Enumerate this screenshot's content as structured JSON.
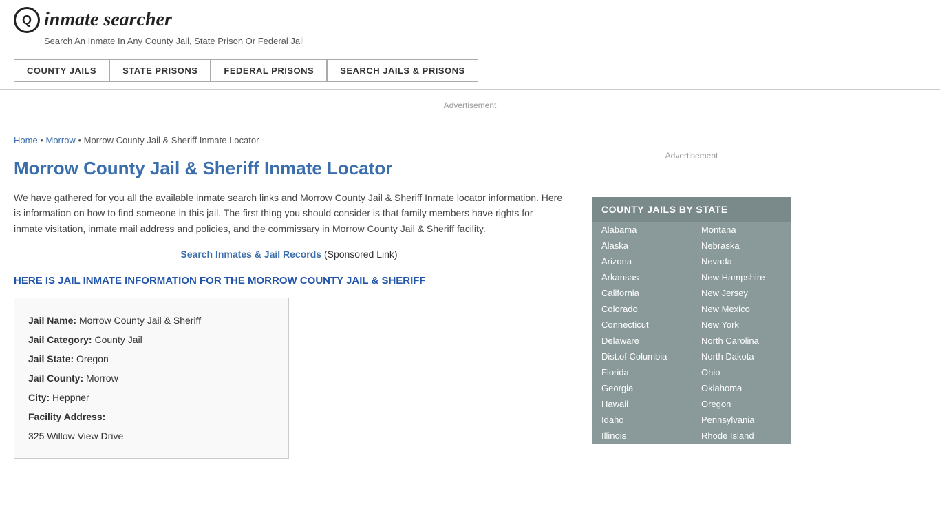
{
  "header": {
    "logo_icon": "Q",
    "logo_text": "inmate searcher",
    "tagline": "Search An Inmate In Any County Jail, State Prison Or Federal Jail"
  },
  "nav": {
    "buttons": [
      {
        "label": "COUNTY JAILS",
        "id": "county-jails"
      },
      {
        "label": "STATE PRISONS",
        "id": "state-prisons"
      },
      {
        "label": "FEDERAL PRISONS",
        "id": "federal-prisons"
      },
      {
        "label": "SEARCH JAILS & PRISONS",
        "id": "search-jails"
      }
    ]
  },
  "ad": {
    "banner_text": "Advertisement"
  },
  "breadcrumb": {
    "home": "Home",
    "morrow": "Morrow",
    "current": "Morrow County Jail & Sheriff Inmate Locator"
  },
  "page": {
    "title": "Morrow County Jail & Sheriff Inmate Locator",
    "description": "We have gathered for you all the available inmate search links and Morrow County Jail & Sheriff Inmate locator information. Here is information on how to find someone in this jail. The first thing you should consider is that family members have rights for inmate visitation, inmate mail address and policies, and the commissary in Morrow County Jail & Sheriff facility.",
    "search_link": "Search Inmates & Jail Records",
    "sponsored": "(Sponsored Link)",
    "jail_info_heading": "HERE IS JAIL INMATE INFORMATION FOR THE MORROW COUNTY JAIL & SHERIFF"
  },
  "jail_info": {
    "name_label": "Jail Name:",
    "name_value": "Morrow County Jail & Sheriff",
    "category_label": "Jail Category:",
    "category_value": "County Jail",
    "state_label": "Jail State:",
    "state_value": "Oregon",
    "county_label": "Jail County:",
    "county_value": "Morrow",
    "city_label": "City:",
    "city_value": "Heppner",
    "address_label": "Facility Address:",
    "address_value": "325 Willow View Drive"
  },
  "sidebar": {
    "ad_text": "Advertisement",
    "state_box_title": "COUNTY JAILS BY STATE",
    "states_col1": [
      "Alabama",
      "Alaska",
      "Arizona",
      "Arkansas",
      "California",
      "Colorado",
      "Connecticut",
      "Delaware",
      "Dist.of Columbia",
      "Florida",
      "Georgia",
      "Hawaii",
      "Idaho",
      "Illinois"
    ],
    "states_col2": [
      "Montana",
      "Nebraska",
      "Nevada",
      "New Hampshire",
      "New Jersey",
      "New Mexico",
      "New York",
      "North Carolina",
      "North Dakota",
      "Ohio",
      "Oklahoma",
      "Oregon",
      "Pennsylvania",
      "Rhode Island"
    ]
  }
}
